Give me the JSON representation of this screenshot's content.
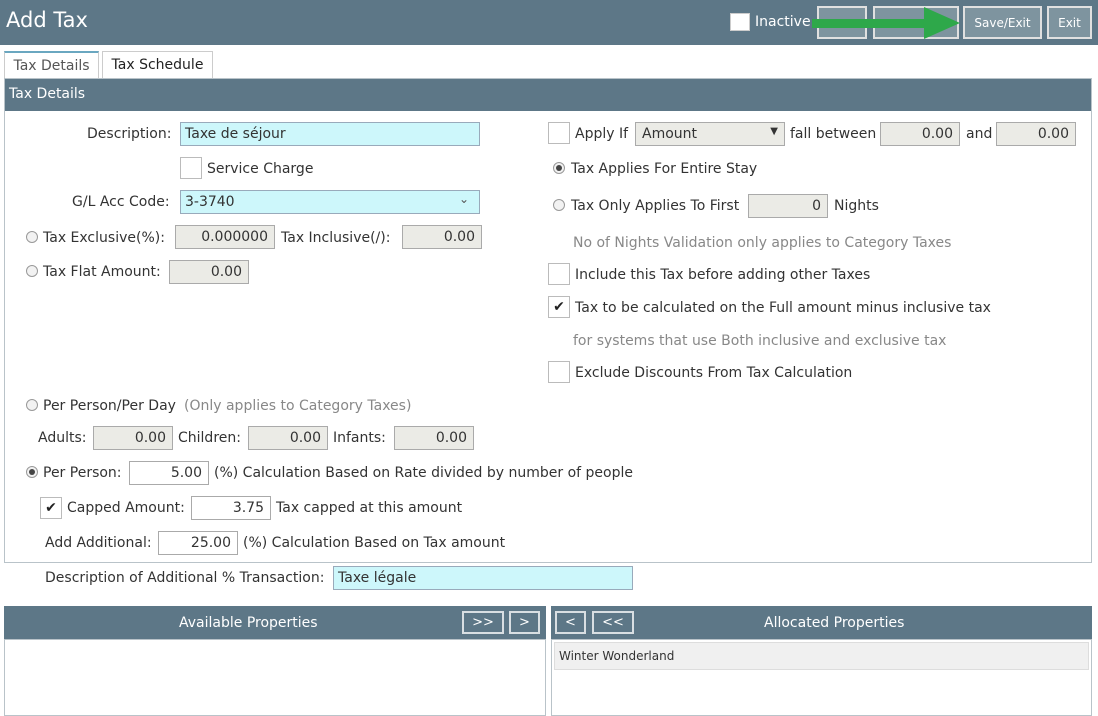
{
  "header": {
    "title": "Add Tax",
    "inactive_label": "Inactive",
    "save_exit_label": "Save/Exit",
    "exit_label": "Exit"
  },
  "tabs": [
    {
      "label": "Tax Details"
    },
    {
      "label": "Tax Schedule"
    }
  ],
  "panel": {
    "title": "Tax Details"
  },
  "left": {
    "description_label": "Description:",
    "description_value": "Taxe de séjour",
    "service_charge_label": "Service Charge",
    "gl_label": "G/L Acc Code:",
    "gl_value": "3-3740",
    "tax_exclusive_label": "Tax Exclusive(%):",
    "tax_exclusive_value": "0.000000",
    "tax_inclusive_label": "Tax Inclusive(/):",
    "tax_inclusive_value": "0.00",
    "flat_amount_label": "Tax Flat Amount:",
    "flat_amount_value": "0.00",
    "per_person_day_label": "Per Person/Per Day",
    "per_person_day_note": "(Only applies to Category Taxes)",
    "adults_label": "Adults:",
    "adults_value": "0.00",
    "children_label": "Children:",
    "children_value": "0.00",
    "infants_label": "Infants:",
    "infants_value": "0.00",
    "per_person_label": "Per Person:",
    "per_person_value": "5.00",
    "per_person_note": "(%) Calculation Based on Rate divided by number of people",
    "capped_label": "Capped Amount:",
    "capped_value": "3.75",
    "capped_note": "Tax capped at this amount",
    "add_additional_label": "Add Additional:",
    "add_additional_value": "25.00",
    "add_additional_note": "(%) Calculation Based on Tax amount",
    "additional_desc_label": "Description of Additional % Transaction:",
    "additional_desc_value": "Taxe légale"
  },
  "right": {
    "apply_if_label": "Apply If",
    "apply_if_select": "Amount",
    "fall_between_label": "fall between",
    "between_from": "0.00",
    "and_label": "and",
    "between_to": "0.00",
    "entire_stay_label": "Tax Applies For Entire Stay",
    "first_nights_label": "Tax Only Applies To First",
    "first_nights_value": "0",
    "nights_label": "Nights",
    "nights_note": "No of Nights Validation only applies to Category Taxes",
    "include_before_label": "Include this Tax before adding other Taxes",
    "full_amount_label": "Tax to be calculated on the Full amount minus inclusive tax",
    "full_amount_note": "for systems that use Both inclusive and exclusive tax",
    "exclude_discounts_label": "Exclude Discounts From Tax Calculation"
  },
  "properties": {
    "available_title": "Available Properties",
    "allocated_title": "Allocated Properties",
    "btn_add_all": ">>",
    "btn_add": ">",
    "btn_remove": "<",
    "btn_remove_all": "<<",
    "allocated_items": [
      "Winter Wonderland"
    ]
  },
  "colors": {
    "header_bg": "#5d7787",
    "input_highlight": "#cdf7fb",
    "arrow": "#2ea84a"
  }
}
